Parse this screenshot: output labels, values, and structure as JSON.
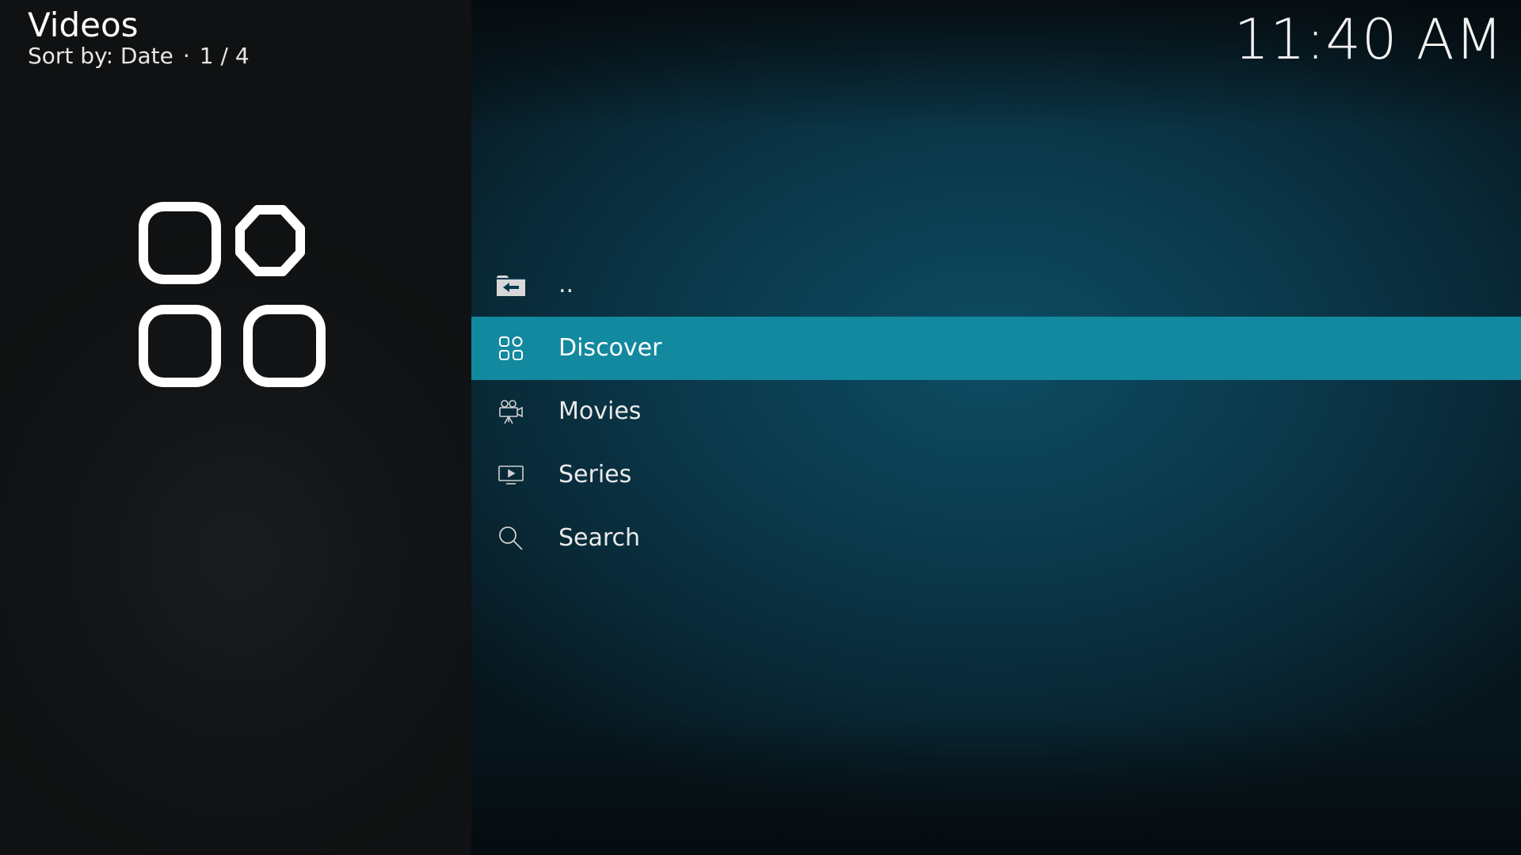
{
  "header": {
    "title": "Videos",
    "sort_label": "Sort by: Date",
    "separator": "·",
    "position": "1 / 4"
  },
  "clock": {
    "time": "11:40 AM"
  },
  "focused_item_icon": "discover-grid-icon",
  "list": {
    "items": [
      {
        "label": "..",
        "icon": "folder-back-icon",
        "focused": false
      },
      {
        "label": "Discover",
        "icon": "discover-grid-icon",
        "focused": true
      },
      {
        "label": "Movies",
        "icon": "movie-camera-icon",
        "focused": false
      },
      {
        "label": "Series",
        "icon": "tv-play-icon",
        "focused": false
      },
      {
        "label": "Search",
        "icon": "search-icon",
        "focused": false
      }
    ]
  },
  "colors": {
    "focus_bar": "#12899f",
    "left_panel": "#121416",
    "background": "#0b3a4d"
  }
}
